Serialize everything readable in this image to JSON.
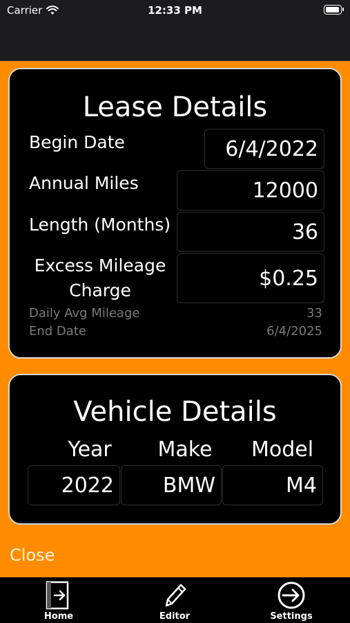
{
  "status": {
    "carrier": "Carrier",
    "time": "12:33 PM"
  },
  "lease": {
    "title": "Lease Details",
    "begin_date_label": "Begin Date",
    "begin_date_value": "6/4/2022",
    "annual_miles_label": "Annual Miles",
    "annual_miles_value": "12000",
    "length_label": "Length (Months)",
    "length_value": "36",
    "excess_label_line1": "Excess Mileage",
    "excess_label_line2": "Charge",
    "excess_value": "$0.25",
    "daily_avg_label": "Daily Avg Mileage",
    "daily_avg_value": "33",
    "end_date_label": "End Date",
    "end_date_value": "6/4/2025"
  },
  "vehicle": {
    "title": "Vehicle Details",
    "year_label": "Year",
    "make_label": "Make",
    "model_label": "Model",
    "year_value": "2022",
    "make_value": "BMW",
    "model_value": "M4"
  },
  "close_label": "Close",
  "tabs": [
    {
      "label": "Home",
      "icon": "door-exit-icon"
    },
    {
      "label": "Editor",
      "icon": "pencil-icon"
    },
    {
      "label": "Settings",
      "icon": "arrow-circle-icon"
    }
  ],
  "colors": {
    "accent": "#ff8c00",
    "card_bg": "#000000",
    "card_border": "#d8d8d8",
    "muted_text": "#7a7a7a"
  }
}
